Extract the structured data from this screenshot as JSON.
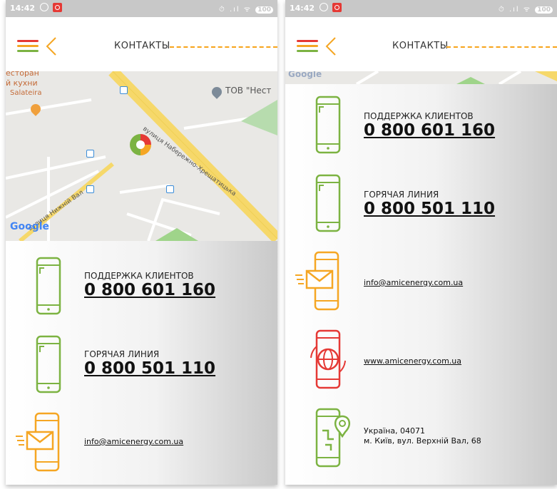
{
  "status_bar": {
    "time": "14:42",
    "battery": "100",
    "signal": "⏱ .ıl ᯤ"
  },
  "header": {
    "title": "КОНТАКТЫ"
  },
  "map": {
    "restaurant_line1": "есторан",
    "restaurant_line2": "й кухни",
    "restaurant_name": "Salateira",
    "poi_label": "ТОВ \"Нест",
    "street_main": "вулиця Набережно-Хрещатицька",
    "street_side": "вулиця Нижній Вал",
    "google": "Google"
  },
  "contacts": {
    "support_label": "ПОДДЕРЖКА КЛИЕНТОВ",
    "support_phone": "0 800 601 160",
    "hotline_label": "ГОРЯЧАЯ ЛИНИЯ",
    "hotline_phone": "0 800 501 110",
    "email": "info@amicenergy.com.ua",
    "website": "www.amicenergy.com.ua",
    "address_line1": "Україна, 04071",
    "address_line2": "м. Київ, вул. Верхній Вал, 68"
  },
  "colors": {
    "red": "#e53935",
    "orange": "#f5a623",
    "green": "#7cb342",
    "dashed_line": "#f7a41a"
  },
  "icons": [
    "hamburger-menu-icon",
    "back-arrow-icon",
    "phone-icon",
    "email-icon",
    "website-globe-icon",
    "location-icon"
  ]
}
